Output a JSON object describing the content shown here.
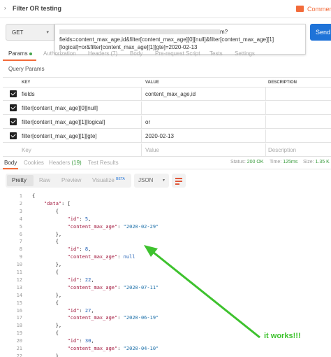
{
  "window": {
    "title": "Filter OR testing",
    "comments_label": "Commen"
  },
  "request": {
    "method": "GET",
    "url_suffix": "m?",
    "url_line2": "fields=content_max_age,id&filter[content_max_age][0][null]&filter[content_max_age][1]",
    "url_line3": "[logical]=or&filter[content_max_age][1][gte]=2020-02-13",
    "send_label": "Send"
  },
  "request_tabs": [
    {
      "label": "Params",
      "active": true
    },
    {
      "label": "Authorization",
      "active": false
    },
    {
      "label": "Headers (7)",
      "active": false
    },
    {
      "label": "Body",
      "active": false
    },
    {
      "label": "Pre-request Script",
      "active": false
    },
    {
      "label": "Tests",
      "active": false
    },
    {
      "label": "Settings",
      "active": false
    }
  ],
  "query_params": {
    "title": "Query Params",
    "headers": {
      "key": "KEY",
      "value": "VALUE",
      "description": "DESCRIPTION"
    },
    "rows": [
      {
        "checked": true,
        "key": "fields",
        "value": "content_max_age,id"
      },
      {
        "checked": true,
        "key": "filter[content_max_age][0][null]",
        "value": ""
      },
      {
        "checked": true,
        "key": "filter[content_max_age][1][logical]",
        "value": "or"
      },
      {
        "checked": true,
        "key": "filter[content_max_age][1][gte]",
        "value": "2020-02-13"
      }
    ],
    "placeholder": {
      "key": "Key",
      "value": "Value",
      "description": "Description"
    }
  },
  "response_tabs": {
    "body": "Body",
    "cookies": "Cookies",
    "headers": "Headers",
    "headers_count": "(19)",
    "test_results": "Test Results"
  },
  "response_status": {
    "status_label": "Status:",
    "status_value": "200 OK",
    "time_label": "Time:",
    "time_value": "125ms",
    "size_label": "Size:",
    "size_value": "1.35 K"
  },
  "view_toolbar": {
    "pretty": "Pretty",
    "raw": "Raw",
    "preview": "Preview",
    "visualize": "Visualize",
    "beta": "BETA",
    "format": "JSON"
  },
  "code_lines": [
    "{",
    "    \"data\": [",
    "        {",
    "            \"id\": 5,",
    "            \"content_max_age\": \"2020-02-29\"",
    "        },",
    "        {",
    "            \"id\": 8,",
    "            \"content_max_age\": null",
    "        },",
    "        {",
    "            \"id\": 22,",
    "            \"content_max_age\": \"2020-07-11\"",
    "        },",
    "        {",
    "            \"id\": 27,",
    "            \"content_max_age\": \"2020-06-19\"",
    "        },",
    "        {",
    "            \"id\": 30,",
    "            \"content_max_age\": \"2020-04-10\"",
    "        },"
  ],
  "annotation": {
    "text": "it works!!!",
    "color": "#3ec22e"
  },
  "colors": {
    "accent": "#f26b3a",
    "send": "#1f73d8",
    "success": "#3a9c3e"
  }
}
